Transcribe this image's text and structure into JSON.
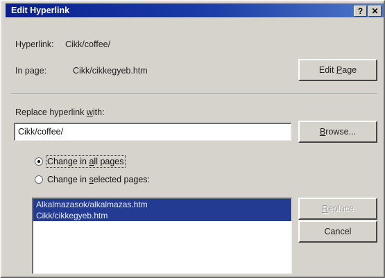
{
  "window": {
    "title": "Edit Hyperlink",
    "help_glyph": "?",
    "close_glyph": "✕"
  },
  "info": {
    "hyperlink_label": "Hyperlink:",
    "hyperlink_value": "Cikk/coffee/",
    "in_page_label": "In page:",
    "in_page_value": "Cikk/cikkegyeb.htm"
  },
  "buttons": {
    "edit_page": {
      "pre": "Edit ",
      "key": "P",
      "post": "age"
    },
    "browse": {
      "pre": "",
      "key": "B",
      "post": "rowse..."
    },
    "replace": {
      "pre": "",
      "key": "R",
      "post": "eplace"
    },
    "cancel": "Cancel"
  },
  "replace_field": {
    "label_pre": "Replace hyperlink ",
    "label_key": "w",
    "label_post": "ith:",
    "value": "Cikk/coffee/"
  },
  "options": {
    "all_pre": "Change in ",
    "all_key": "a",
    "all_post": "ll pages",
    "selected_pre": "Change in ",
    "selected_key": "s",
    "selected_post": "elected pages:"
  },
  "pages": [
    "Alkalmazasok/alkalmazas.htm",
    "Cikk/cikkegyeb.htm"
  ]
}
